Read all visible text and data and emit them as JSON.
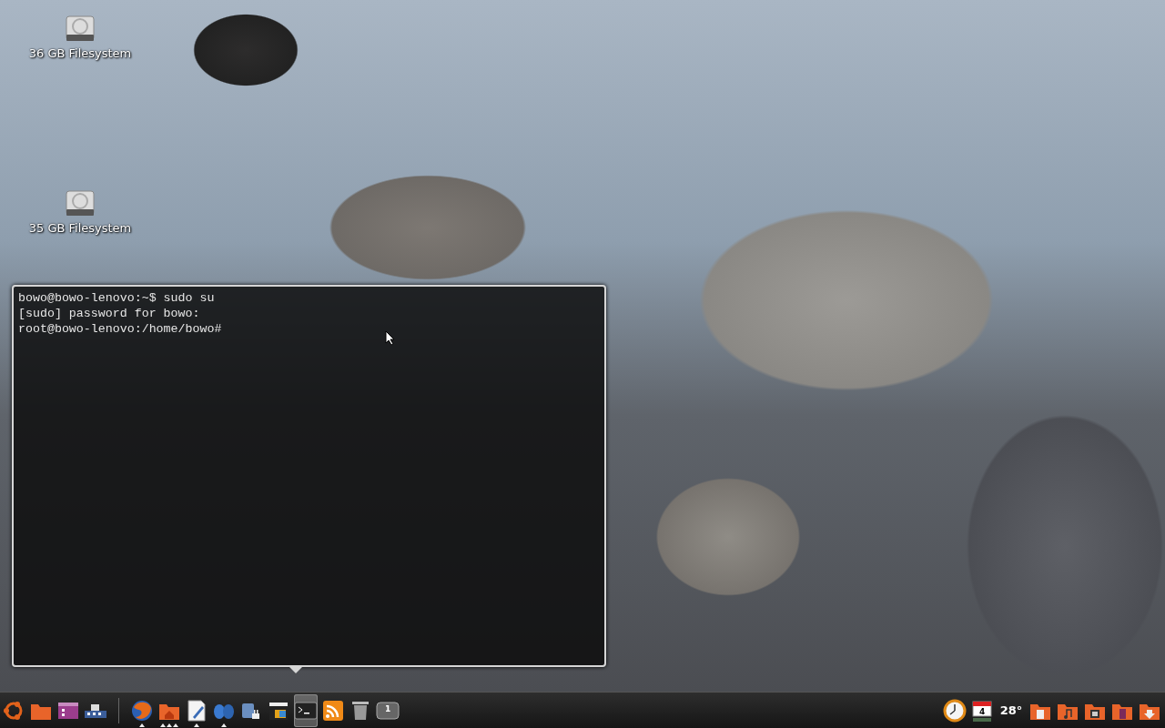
{
  "desktop_icons": [
    {
      "label": "36 GB Filesystem"
    },
    {
      "label": "35 GB Filesystem"
    }
  ],
  "terminal": {
    "lines": [
      "bowo@bowo-lenovo:~$ sudo su",
      "[sudo] password for bowo:",
      "root@bowo-lenovo:/home/bowo#"
    ]
  },
  "dock": {
    "left_items": [
      {
        "kind": "ubuntu",
        "running": false,
        "multiple_windows": false,
        "selected": false
      },
      {
        "kind": "folder",
        "running": false,
        "multiple_windows": false,
        "selected": false
      },
      {
        "kind": "app-window",
        "running": false,
        "multiple_windows": false,
        "selected": false
      },
      {
        "kind": "network",
        "running": false,
        "multiple_windows": false,
        "selected": false
      },
      {
        "kind": "separator"
      },
      {
        "kind": "globe",
        "running": true,
        "multiple_windows": false,
        "selected": false
      },
      {
        "kind": "home-folder",
        "running": true,
        "multiple_windows": true,
        "selected": false
      },
      {
        "kind": "text-editor",
        "running": true,
        "multiple_windows": false,
        "selected": false
      },
      {
        "kind": "chat",
        "running": true,
        "multiple_windows": false,
        "selected": false
      },
      {
        "kind": "plug",
        "running": false,
        "multiple_windows": false,
        "selected": false
      },
      {
        "kind": "clapper",
        "running": false,
        "multiple_windows": false,
        "selected": false
      },
      {
        "kind": "terminal",
        "running": false,
        "multiple_windows": false,
        "selected": true
      },
      {
        "kind": "rss",
        "running": false,
        "multiple_windows": false,
        "selected": false
      },
      {
        "kind": "trash",
        "running": false,
        "multiple_windows": false,
        "selected": false
      },
      {
        "kind": "workspace",
        "running": false,
        "multiple_windows": false,
        "selected": false,
        "text": "1"
      }
    ],
    "right_items": [
      {
        "kind": "clock"
      },
      {
        "kind": "calendar",
        "text": "4"
      },
      {
        "kind": "weather",
        "text": "28°"
      },
      {
        "kind": "folder-document"
      },
      {
        "kind": "folder-music"
      },
      {
        "kind": "folder-picture"
      },
      {
        "kind": "folder-video"
      },
      {
        "kind": "folder-download"
      }
    ]
  }
}
